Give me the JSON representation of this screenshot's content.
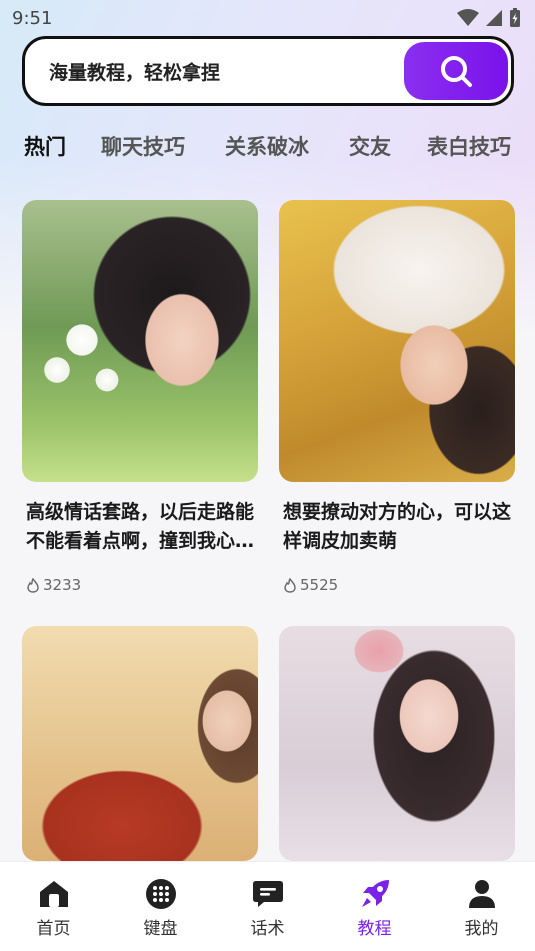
{
  "status": {
    "time": "9:51"
  },
  "search": {
    "placeholder": "海量教程，轻松拿捏"
  },
  "tabs": [
    {
      "label": "热门"
    },
    {
      "label": "聊天技巧"
    },
    {
      "label": "关系破冰"
    },
    {
      "label": "交友"
    },
    {
      "label": "表白技巧"
    }
  ],
  "cards": [
    {
      "title": "高级情话套路，以后走路能不能看着点啊，撞到我心里了",
      "count": "3233"
    },
    {
      "title": "想要撩动对方的心，可以这样调皮加卖萌",
      "count": "5525"
    },
    {
      "title": "",
      "count": ""
    },
    {
      "title": "",
      "count": ""
    }
  ],
  "nav": [
    {
      "label": "首页",
      "icon": "home-icon"
    },
    {
      "label": "键盘",
      "icon": "keyboard-icon"
    },
    {
      "label": "话术",
      "icon": "chat-icon"
    },
    {
      "label": "教程",
      "icon": "rocket-icon"
    },
    {
      "label": "我的",
      "icon": "profile-icon"
    }
  ],
  "colors": {
    "accent": "#7a22e8",
    "search_btn": "#8a2ff0"
  }
}
